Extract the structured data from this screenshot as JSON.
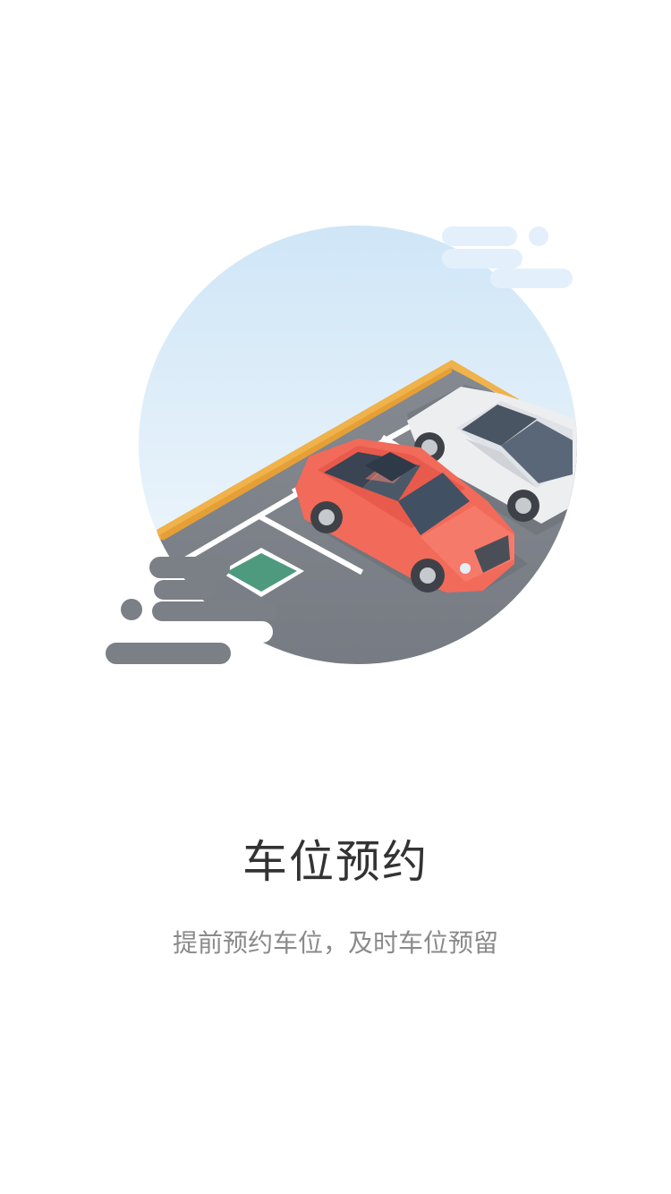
{
  "onboarding": {
    "title": "车位预约",
    "subtitle": "提前预约车位，及时车位预留"
  },
  "illustration": {
    "icon": "parking-reservation-illustration",
    "colors": {
      "sky_top": "#cfe6f7",
      "sky_bottom": "#f3f8fc",
      "asphalt": "#7b7f86",
      "curb": "#f0b24a",
      "cloud": "#e3f0fb",
      "red_car": "#f16a5a",
      "white_car": "#eceef0",
      "parking_marker": "#4e9a7e",
      "speed_lines": "#7b7f86"
    }
  }
}
